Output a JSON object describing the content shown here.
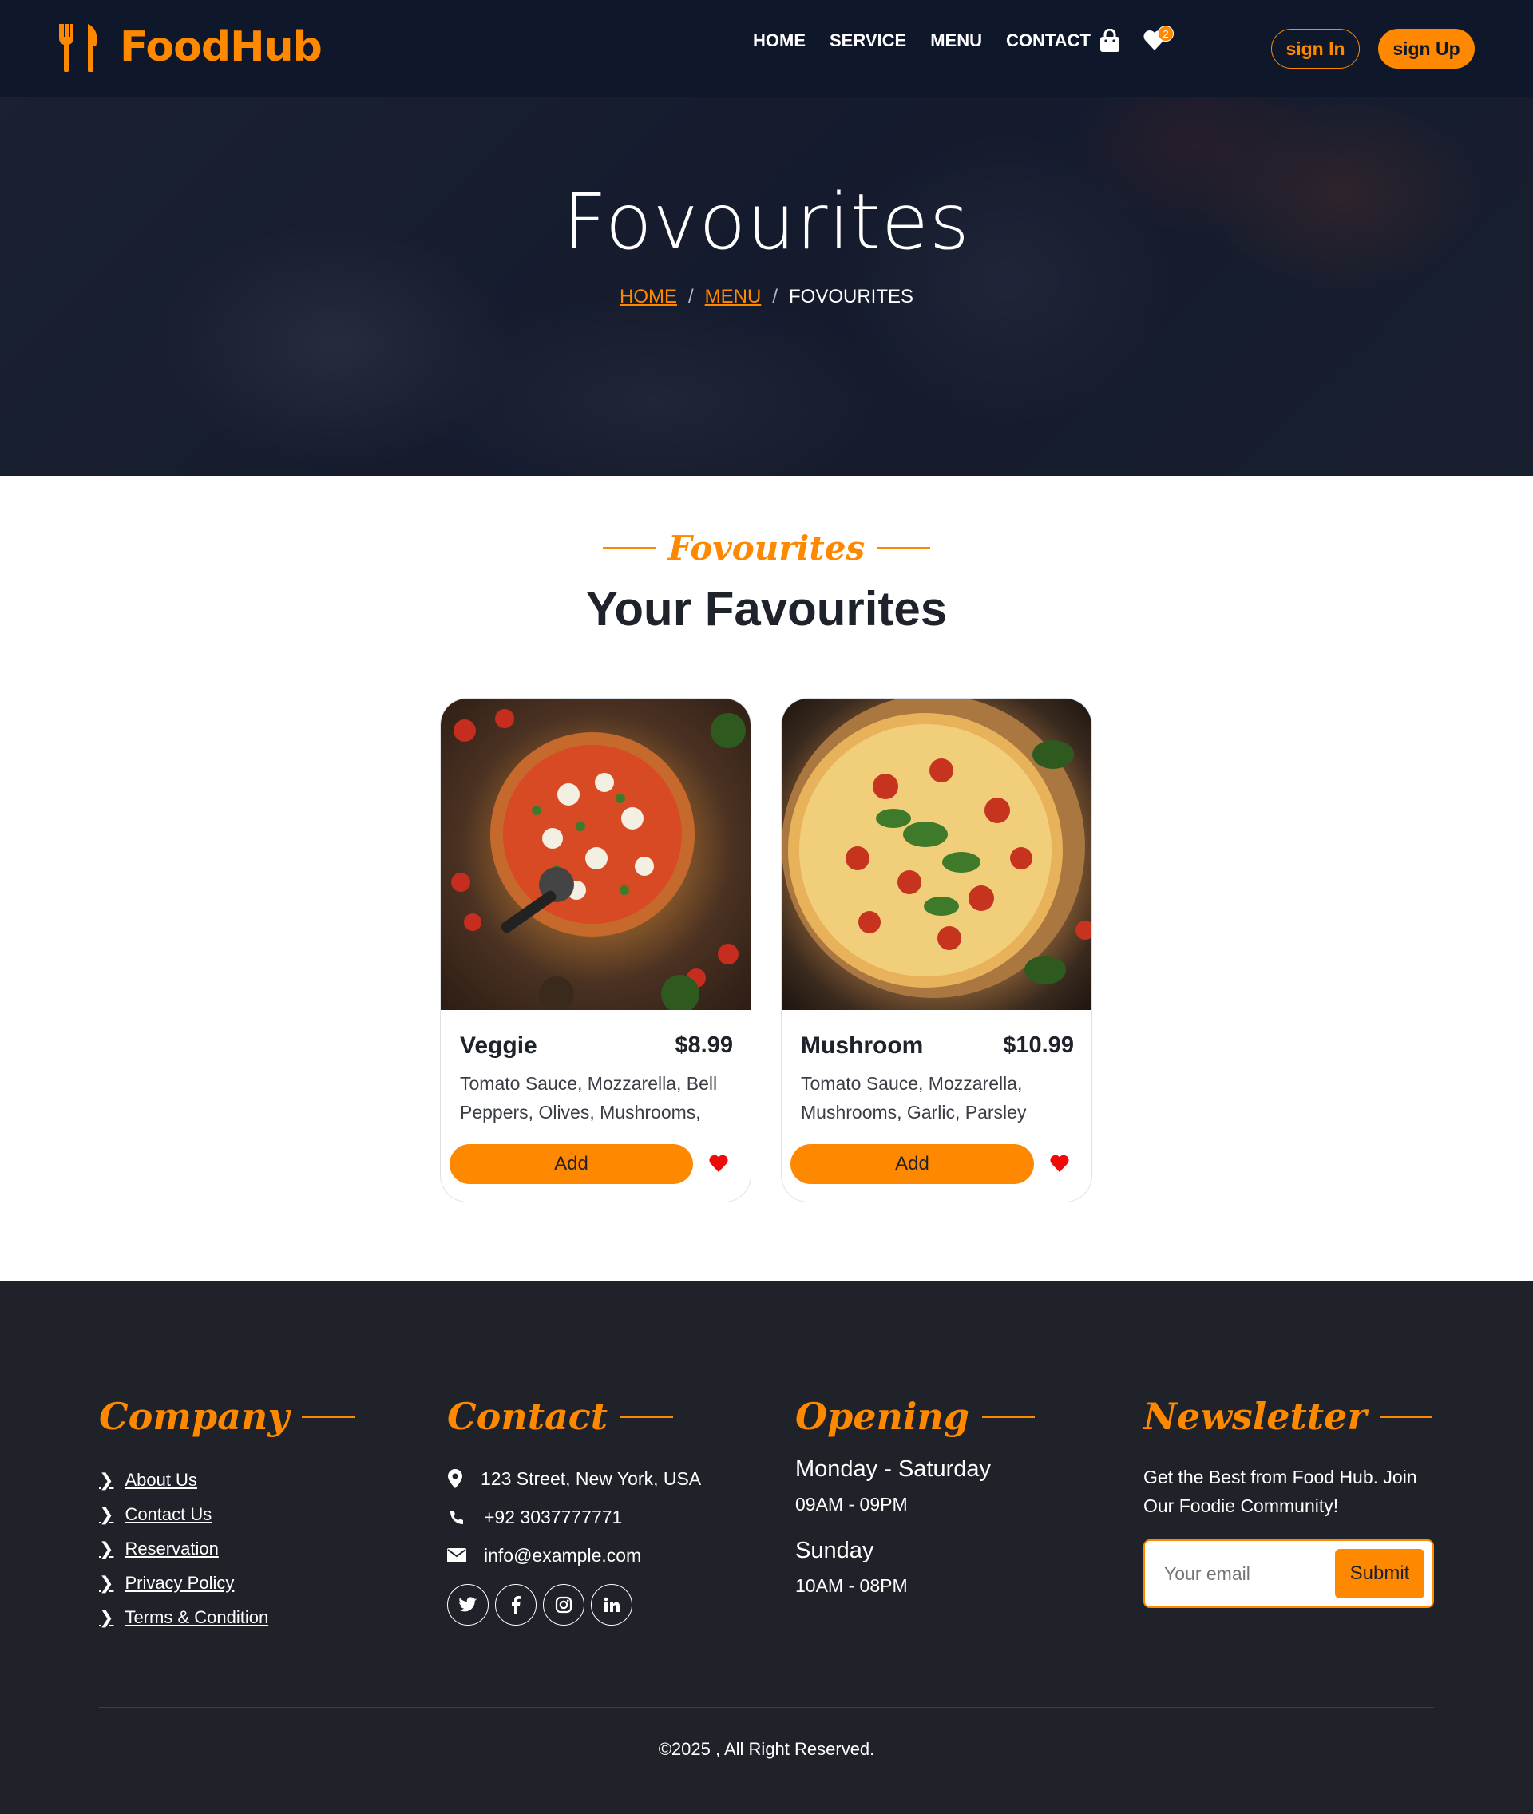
{
  "brand": {
    "name": "FoodHub",
    "color": "#fe8800"
  },
  "nav": {
    "links": [
      "HOME",
      "SERVICE",
      "MENU",
      "CONTACT"
    ],
    "favourites_count": "2",
    "signin_label": "sign In",
    "signup_label": "sign Up"
  },
  "hero": {
    "title": "Fovourites",
    "breadcrumb": {
      "home": "HOME",
      "menu": "MENU",
      "current": "FOVOURITES",
      "separator": "/"
    }
  },
  "section": {
    "subtitle": "Fovourites",
    "title": "Your Favourites"
  },
  "cards": [
    {
      "name": "Veggie",
      "price": "$8.99",
      "description": "Tomato Sauce, Mozzarella, Bell Peppers, Olives, Mushrooms,",
      "button": "Add"
    },
    {
      "name": "Mushroom",
      "price": "$10.99",
      "description": "Tomato Sauce, Mozzarella, Mushrooms, Garlic, Parsley",
      "button": "Add"
    }
  ],
  "footer": {
    "company": {
      "heading": "Company",
      "links": [
        "About Us",
        "Contact Us",
        "Reservation",
        "Privacy Policy",
        "Terms & Condition"
      ]
    },
    "contact": {
      "heading": "Contact",
      "address": "123 Street, New York, USA",
      "phone": "+92 3037777771",
      "email": "info@example.com",
      "socials": [
        "twitter-icon",
        "facebook-icon",
        "instagram-icon",
        "linkedin-icon"
      ]
    },
    "opening": {
      "heading": "Opening",
      "day1": "Monday - Saturday",
      "time1": "09AM - 09PM",
      "day2": "Sunday",
      "time2": "10AM - 08PM"
    },
    "newsletter": {
      "heading": "Newsletter",
      "text": "Get the Best from Food Hub. Join Our Foodie Community!",
      "placeholder": "Your email",
      "submit": "Submit"
    },
    "copyright": "©2025 , All Right Reserved."
  }
}
